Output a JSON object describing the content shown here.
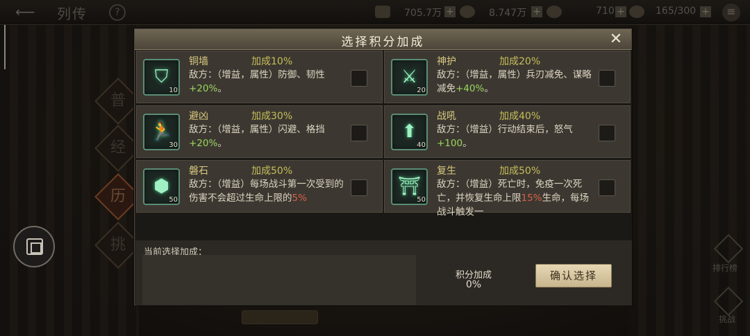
{
  "top_bar": {
    "title": "列传",
    "help": "?",
    "res1": "705.7万",
    "res2": "8.747万",
    "res3": "710",
    "res4": "165/300",
    "plus": "+"
  },
  "side_tabs": [
    "普",
    "经",
    "历",
    "挑"
  ],
  "right_actions": [
    {
      "label": "排行榜"
    },
    {
      "label": "挑战"
    }
  ],
  "dialog": {
    "title": "选择积分加成",
    "close": "✕",
    "cards": [
      {
        "name": "铜墙",
        "bonus": "加成10%",
        "cost": "10",
        "icon": "shield-icon",
        "glyph": "⛉",
        "desc_a": "敌方：（增益，属性）防御、韧性",
        "desc_b": "+20%",
        "desc_c": "。"
      },
      {
        "name": "神护",
        "bonus": "加成20%",
        "cost": "20",
        "icon": "sword-break-icon",
        "glyph": "⚔",
        "desc_a": "敌方：（增益，属性）兵刃减免、谋略减免",
        "desc_b": "+40%",
        "desc_c": "。"
      },
      {
        "name": "避凶",
        "bonus": "加成30%",
        "cost": "30",
        "icon": "running-figure-icon",
        "glyph": "🏃",
        "desc_a": "敌方：（增益，属性）闪避、格挡",
        "desc_b": "+20%",
        "desc_c": "。"
      },
      {
        "name": "战吼",
        "bonus": "加成40%",
        "cost": "40",
        "icon": "up-arrow-circle-icon",
        "glyph": "⬆",
        "desc_a": "敌方：（增益）行动结束后，怒气",
        "desc_b": "+100",
        "desc_c": "。"
      },
      {
        "name": "磐石",
        "bonus": "加成50%",
        "cost": "50",
        "icon": "rock-shield-icon",
        "glyph": "⬢",
        "desc_a": "敌方：（增益）每场战斗第一次受到的伤害不会超过生命上限的",
        "desc_b": "5%",
        "desc_c": ""
      },
      {
        "name": "复生",
        "bonus": "加成50%",
        "cost": "50",
        "icon": "revive-altar-icon",
        "glyph": "⛩",
        "desc_a": "敌方：（增益）死亡时，免疫一次死亡，并恢复生命上限",
        "desc_b": "15%",
        "desc_c": "生命，每场战斗触发一"
      }
    ],
    "current_label": "当前选择加成：",
    "points_label": "积分加成",
    "points_value": "0%",
    "confirm": "确认选择"
  }
}
